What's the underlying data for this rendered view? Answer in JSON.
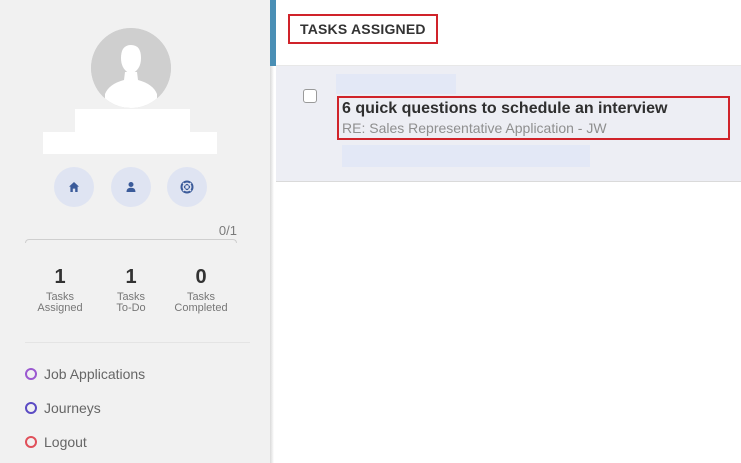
{
  "sidebar": {
    "progress": {
      "text": "0/1",
      "completed": 0,
      "total": 1
    },
    "icons": [
      "home-icon",
      "user-icon",
      "lifebuoy-icon"
    ],
    "stats": [
      {
        "value": "1",
        "label_line1": "Tasks",
        "label_line2": "Assigned"
      },
      {
        "value": "1",
        "label_line1": "Tasks",
        "label_line2": "To-Do"
      },
      {
        "value": "0",
        "label_line1": "Tasks",
        "label_line2": "Completed"
      }
    ],
    "nav": [
      {
        "label": "Job Applications",
        "color": "#9b59d0"
      },
      {
        "label": "Journeys",
        "color": "#5b4bc4"
      },
      {
        "label": "Logout",
        "color": "#e0505a"
      }
    ]
  },
  "main": {
    "header_title": "TASKS ASSIGNED",
    "tasks": [
      {
        "title": "6 quick questions to schedule an interview",
        "subtitle": "RE: Sales Representative Application - JW",
        "checked": false
      }
    ]
  },
  "colors": {
    "accent": "#4a8fb5",
    "highlight_border": "#d0232a",
    "icon_bg": "#dfe4f2",
    "icon_fg": "#3b5b9a"
  }
}
